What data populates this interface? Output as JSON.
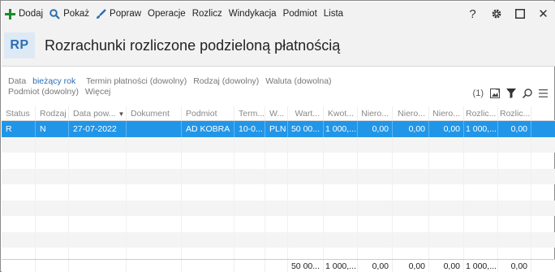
{
  "toolbar": {
    "items": [
      {
        "label": "Dodaj",
        "icon": "plus-icon"
      },
      {
        "label": "Pokaż",
        "icon": "search-icon"
      },
      {
        "label": "Popraw",
        "icon": "brush-icon"
      },
      {
        "label": "Operacje"
      },
      {
        "label": "Rozlicz"
      },
      {
        "label": "Windykacja"
      },
      {
        "label": "Podmiot"
      },
      {
        "label": "Lista"
      }
    ],
    "right_icons": [
      "help-icon",
      "gear-icon",
      "maximize-icon",
      "close-icon"
    ],
    "help_glyph": "?",
    "close_glyph": "✕"
  },
  "header": {
    "badge": "RP",
    "title": "Rozrachunki rozliczone podzieloną płatnością"
  },
  "filters": {
    "date_label": "Data",
    "date_value": "bieżący rok",
    "items": [
      "Termin płatności (dowolny)",
      "Rodzaj (dowolny)",
      "Waluta (dowolna)",
      "Podmiot (dowolny)",
      "Więcej"
    ],
    "count": "(1)"
  },
  "grid": {
    "columns": [
      "Status",
      "Rodzaj",
      "Data pow...",
      "Dokument",
      "Podmiot",
      "Term...",
      "W...",
      "Wart...",
      "Kwot...",
      "Niero...",
      "Niero...",
      "Niero...",
      "Rozlic...",
      "Rozlic..."
    ],
    "sort_indicator": "▼",
    "rows": [
      [
        "R",
        "N",
        "27-07-2022",
        "",
        "AD KOBRA",
        "10-0...",
        "PLN",
        "50 00...",
        "1 000,...",
        "0,00",
        "0,00",
        "0,00",
        "1 000,...",
        "0,00"
      ]
    ],
    "empty_rows": 8,
    "totals": [
      "",
      "",
      "",
      "",
      "",
      "",
      "",
      "50 00...",
      "1 000,...",
      "0,00",
      "0,00",
      "0,00",
      "1 000,...",
      "0,00"
    ]
  },
  "colors": {
    "accent": "#2196e8",
    "badge_bg": "#dde9f5",
    "badge_text": "#2c6fb1",
    "plus_green": "#1a8a2e",
    "link_blue": "#2c6fb1"
  }
}
